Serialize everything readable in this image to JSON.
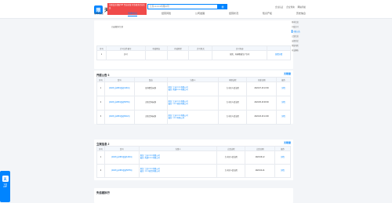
{
  "header": {
    "logo_text": "天眼查",
    "ad_text": "注册会员领取VIP 至高价值 可查更多企业信息",
    "search_value": "江苏××××××有限公司",
    "search_btn": "搜",
    "links": [
      "企业认证",
      "企业查询",
      "网站导航"
    ],
    "tabs": [
      "基本信息",
      "法律诉讼",
      "经营风险",
      "公司发展",
      "经营状况",
      "知识产权",
      "历史信息"
    ]
  },
  "first_card": {
    "note": "已被撤销/注销",
    "columns": [
      "序号",
      "许可文件编号",
      "有效期自",
      "有效期至",
      "许可机关",
      "许可内容"
    ],
    "row": [
      "1",
      "许可",
      "",
      "",
      "",
      "危险、有害物质生产许可",
      "查看详情"
    ]
  },
  "announce": {
    "title": "开庭公告 3",
    "watermark": "天眼查",
    "columns": [
      "序号",
      "案号",
      "案由",
      "当事人",
      "审理法院",
      "开庭日期",
      "操作"
    ],
    "rows": [
      {
        "no": "1",
        "case": "(2023) 苏0981民初1234号",
        "reason": "民间借贷纠纷",
        "party": "原告: 江苏××××有限公司\n被告: 南通××××有限公司",
        "court": "大丰区人民法院",
        "date": "2023-07-16 13:30",
        "op": "详情"
      },
      {
        "no": "2",
        "case": "(2023) 苏0981民初5678号",
        "reason": "买卖合同纠纷",
        "party": "原告: 江苏××××有限公司\n被告: ××××商贸有限公司",
        "court": "大丰区人民法院",
        "date": "2023-05-16 09:30",
        "op": "详情"
      },
      {
        "no": "3",
        "case": "(2023) 苏0981民初9012号",
        "reason": "买卖合同纠纷",
        "party": "原告: 江苏××××有限公司\n被告: ××××有限公司",
        "court": "大丰区人民法院",
        "date": "2023-03-16 14:00",
        "op": "详情"
      }
    ]
  },
  "legal_docs": {
    "title": "立案信息 2",
    "watermark": "天眼查",
    "columns": [
      "序号",
      "案号",
      "当事人",
      "立案法院",
      "立案日期",
      "操作"
    ],
    "rows": [
      {
        "no": "1",
        "case": "(2023) 苏0981民初1234号",
        "party": "原告: 江苏××××有限公司\n被告: 南通××××有限公司",
        "court": "大丰区人民法院",
        "date": "2023-06-12",
        "op": "详情"
      },
      {
        "no": "2",
        "case": "(2023) 苏0981民初5678号",
        "party": "原告: 江苏××××有限公司\n被告: ××××商贸有限公司",
        "court": "大丰区人民法院",
        "date": "2023-04-21",
        "op": "详情"
      }
    ]
  },
  "footer_section": {
    "title": "失信被执行"
  },
  "right_nav": [
    "基本信息",
    "行政许可",
    "开庭公告",
    "立案信息",
    "法律诉讼",
    "经营风险",
    "司法解析"
  ],
  "app_badge": {
    "icon": "天",
    "line1": "下载",
    "line2": "APP"
  }
}
